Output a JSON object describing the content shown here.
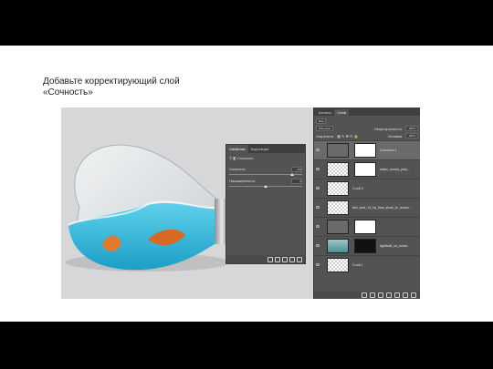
{
  "caption": "Добавьте корректирующий слой «Сочность»",
  "properties_panel": {
    "tab_active": "Свойства",
    "tab_other": "Коррекция",
    "title": "Сочность",
    "vibrance_label": "Сочность:",
    "vibrance_value": "+50",
    "vibrance_level": 0.85,
    "saturation_label": "Насыщенность:",
    "saturation_value": "0",
    "saturation_level": 0.5
  },
  "layers_panel": {
    "tab_other": "Каналы",
    "tab_active": "Слои",
    "kind": "Вид",
    "blend_mode": "Обычные",
    "opacity_label": "Непрозрачность:",
    "opacity_value": "100%",
    "lock_label": "Закрепить:",
    "fill_label": "Заливка:",
    "fill_value": "100%",
    "layers": [
      {
        "name": "Сочность 1"
      },
      {
        "name": "water_aurora_poly..."
      },
      {
        "name": "Слой 3"
      },
      {
        "name": "fish_tank_13_by_fiwa_stock_fc_remov..."
      },
      {
        "name": ""
      },
      {
        "name": "lightbulb_on_isolat..."
      },
      {
        "name": "Слой 1"
      }
    ]
  },
  "colors": {
    "panel_bg": "#535353",
    "water": "#2ab3d6",
    "fish": "#e27a2e"
  }
}
